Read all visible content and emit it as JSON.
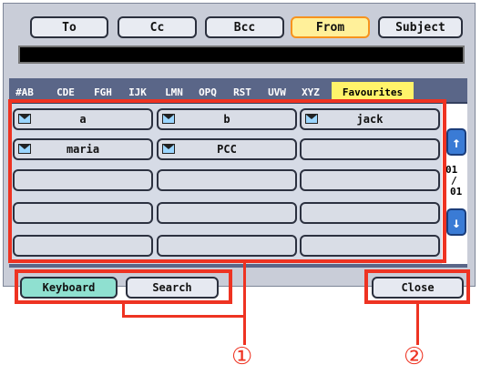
{
  "header_buttons": [
    "To",
    "Cc",
    "Bcc",
    "From",
    "Subject"
  ],
  "tabs": [
    "#AB",
    "CDE",
    "FGH",
    "IJK",
    "LMN",
    "OPQ",
    "RST",
    "UVW",
    "XYZ",
    "Favourites"
  ],
  "grid": {
    "r1c1": "a",
    "r1c2": "b",
    "r1c3": "jack",
    "r2c1": "maria",
    "r2c2": "PCC"
  },
  "pager": {
    "current": "01",
    "sep": "/",
    "total": "01"
  },
  "bottom": {
    "keyboard": "Keyboard",
    "search": "Search",
    "close": "Close"
  },
  "callouts": {
    "one": "①",
    "two": "②"
  },
  "colors": {
    "highlight": "#ee3322",
    "active_tab": "#fff36a"
  }
}
